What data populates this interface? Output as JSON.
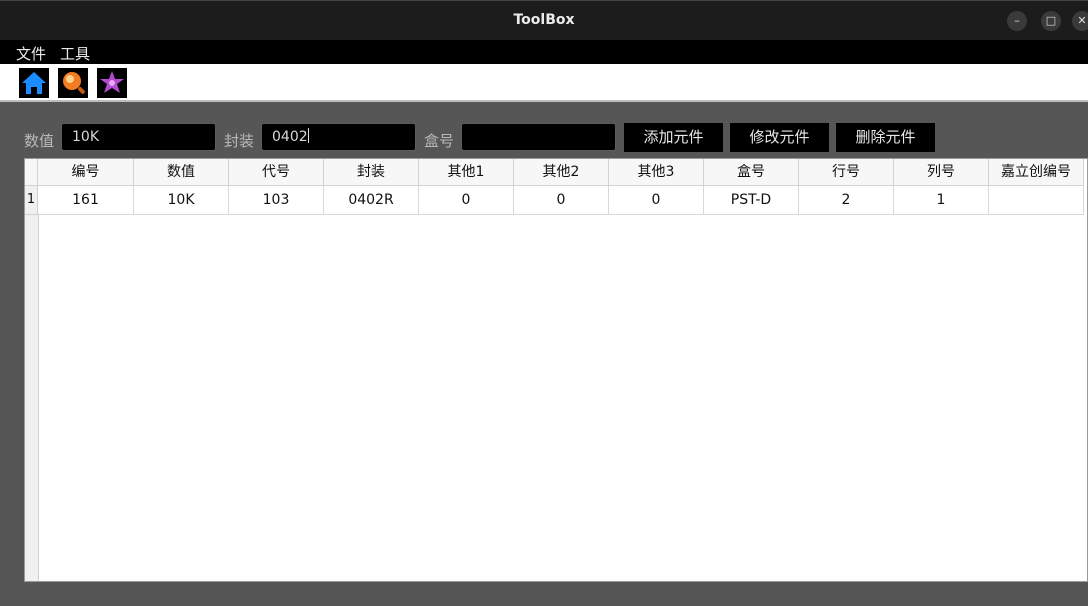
{
  "window": {
    "title": "ToolBox",
    "min_glyph": "–",
    "max_glyph": "□",
    "close_glyph": "✕"
  },
  "menu": {
    "items": [
      "文件",
      "工具"
    ]
  },
  "toolbar": {
    "icons": [
      "home-icon",
      "search-icon",
      "star-icon"
    ]
  },
  "form": {
    "value_label": "数值",
    "value_input": "10K",
    "package_label": "封装",
    "package_input": "0402",
    "box_label": "盒号",
    "box_input": ""
  },
  "actions": {
    "add_label": "添加元件",
    "edit_label": "修改元件",
    "delete_label": "删除元件"
  },
  "table": {
    "columns": [
      "编号",
      "数值",
      "代号",
      "封装",
      "其他1",
      "其他2",
      "其他3",
      "盒号",
      "行号",
      "列号",
      "嘉立创编号"
    ],
    "rows": [
      {
        "header": "1",
        "cells": [
          "161",
          "10K",
          "103",
          "0402R",
          "0",
          "0",
          "0",
          "PST-D",
          "2",
          "1",
          ""
        ]
      }
    ]
  },
  "colors": {
    "titlebar": "#1c1c1c",
    "menubar": "#000000",
    "main_bg": "#565656",
    "home_icon": "#1a8cff",
    "search_icon": "#f07c24",
    "star_icon": "#b04ad0"
  }
}
